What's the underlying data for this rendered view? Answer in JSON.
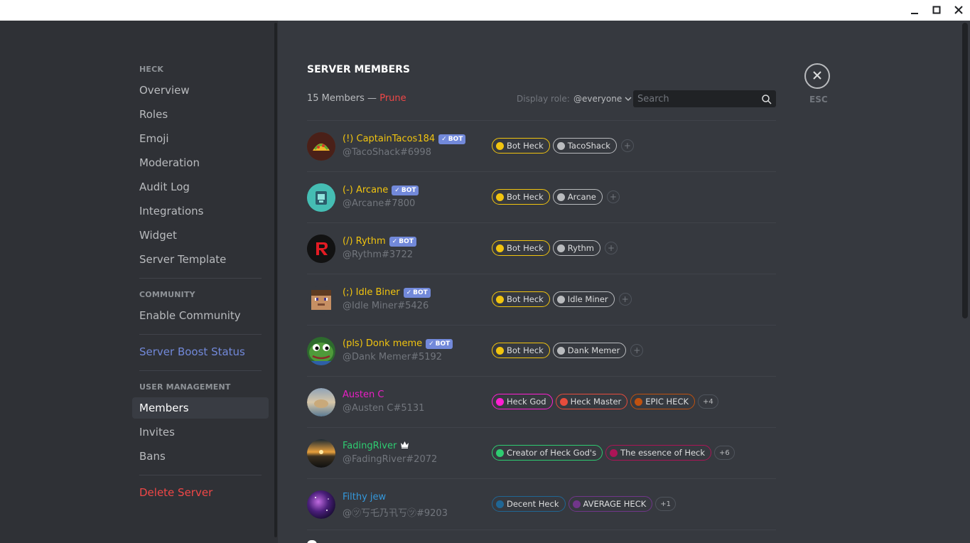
{
  "window": {
    "controls": [
      "minimize-icon",
      "maximize-icon",
      "close-icon"
    ]
  },
  "sidebar": {
    "server_header": "HECK",
    "server_items": [
      {
        "label": "Overview"
      },
      {
        "label": "Roles"
      },
      {
        "label": "Emoji"
      },
      {
        "label": "Moderation"
      },
      {
        "label": "Audit Log"
      },
      {
        "label": "Integrations"
      },
      {
        "label": "Widget"
      },
      {
        "label": "Server Template"
      }
    ],
    "community_header": "COMMUNITY",
    "community_items": [
      {
        "label": "Enable Community"
      }
    ],
    "boost_label": "Server Boost Status",
    "user_mgmt_header": "USER MANAGEMENT",
    "user_mgmt_items": [
      {
        "label": "Members"
      },
      {
        "label": "Invites"
      },
      {
        "label": "Bans"
      }
    ],
    "delete_label": "Delete Server"
  },
  "main": {
    "title": "SERVER MEMBERS",
    "members_count": "15 Members —",
    "prune_label": "Prune",
    "display_role_label": "Display role:",
    "display_role_value": "@everyone",
    "search_placeholder": "Search",
    "esc_label": "ESC",
    "bot_label": "BOT",
    "members": [
      {
        "name": "(!) CaptainTacos184",
        "tag": "@TacoShack#6998",
        "name_color": "#f1c40f",
        "bot": true,
        "avatar": "taco-avatar",
        "roles": [
          {
            "label": "Bot Heck",
            "color": "#f1c40f"
          },
          {
            "label": "TacoShack",
            "color": "#b9bbbe"
          }
        ],
        "add": "+"
      },
      {
        "name": "(-) Arcane",
        "tag": "@Arcane#7800",
        "name_color": "#f1c40f",
        "bot": true,
        "avatar": "arcane-avatar",
        "roles": [
          {
            "label": "Bot Heck",
            "color": "#f1c40f"
          },
          {
            "label": "Arcane",
            "color": "#b9bbbe"
          }
        ],
        "add": "+"
      },
      {
        "name": "(/) Rythm",
        "tag": "@Rythm#3722",
        "name_color": "#f1c40f",
        "bot": true,
        "avatar": "rythm-avatar",
        "roles": [
          {
            "label": "Bot Heck",
            "color": "#f1c40f"
          },
          {
            "label": "Rythm",
            "color": "#b9bbbe"
          }
        ],
        "add": "+"
      },
      {
        "name": "(;) Idle Biner",
        "tag": "@Idle Miner#5426",
        "name_color": "#f1c40f",
        "bot": true,
        "avatar": "idle-miner-avatar",
        "roles": [
          {
            "label": "Bot Heck",
            "color": "#f1c40f"
          },
          {
            "label": "Idle Miner",
            "color": "#b9bbbe"
          }
        ],
        "add": "+"
      },
      {
        "name": "(pls) Donk meme",
        "tag": "@Dank Memer#5192",
        "name_color": "#f1c40f",
        "bot": true,
        "avatar": "dank-memer-avatar",
        "roles": [
          {
            "label": "Bot Heck",
            "color": "#f1c40f"
          },
          {
            "label": "Dank Memer",
            "color": "#b9bbbe"
          }
        ],
        "add": "+"
      },
      {
        "name": "Austen C",
        "tag": "@Austen C#5131",
        "name_color": "#e91ec4",
        "bot": false,
        "avatar": "austen-avatar",
        "roles": [
          {
            "label": "Heck God",
            "color": "#ff1fd2"
          },
          {
            "label": "Heck Master",
            "color": "#e74c3c"
          },
          {
            "label": "EPIC HECK",
            "color": "#c0510f"
          }
        ],
        "more": "+4"
      },
      {
        "name": "FadingRiver",
        "tag": "@FadingRiver#2072",
        "name_color": "#2ecc71",
        "bot": false,
        "owner": true,
        "avatar": "fadingriver-avatar",
        "roles": [
          {
            "label": "Creator of Heck God's",
            "color": "#2ecc71"
          },
          {
            "label": "The essence of Heck",
            "color": "#ad1457"
          }
        ],
        "more": "+6"
      },
      {
        "name": "Filthy jew",
        "tag": "@㋡丂乇乃卂丂㋡#9203",
        "name_color": "#3498db",
        "bot": false,
        "avatar": "galaxy-avatar",
        "roles": [
          {
            "label": "Decent Heck",
            "color": "#206694"
          },
          {
            "label": "AVERAGE HECK",
            "color": "#71368a"
          }
        ],
        "more": "+1"
      }
    ]
  }
}
